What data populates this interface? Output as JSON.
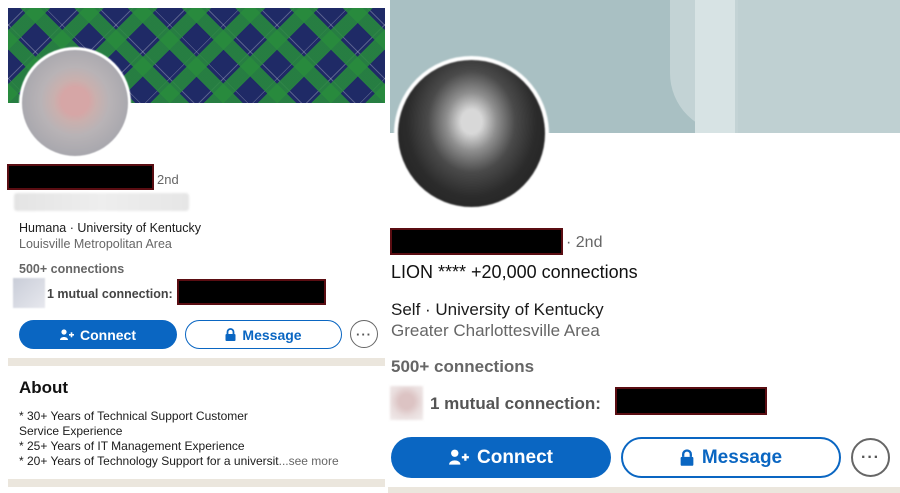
{
  "colors": {
    "accent": "#0a66c2",
    "muted_text": "#666666",
    "redaction": "#000000",
    "divider": "#ebe6dd"
  },
  "left_profile": {
    "degree": "2nd",
    "workplace": "Humana · University of Kentucky",
    "location": "Louisville Metropolitan Area",
    "connections": "500+ connections",
    "mutual_connection": "1 mutual connection:",
    "connect_label": "Connect",
    "connect_icon": "add-person-icon",
    "message_label": "Message",
    "message_icon": "lock-icon",
    "more_label": "···",
    "about": {
      "title": "About",
      "lines": [
        "* 30+ Years of Technical Support Customer",
        "Service Experience",
        "* 25+ Years of IT Management Experience",
        "* 20+ Years of Technology Support for a universit"
      ],
      "see_more": "...see more"
    }
  },
  "right_profile": {
    "degree": "· 2nd",
    "headline": "LION **** +20,000 connections",
    "workplace": "Self · University of Kentucky",
    "location": "Greater Charlottesville Area",
    "connections": "500+ connections",
    "mutual_connection": "1 mutual connection:",
    "connect_label": "Connect",
    "connect_icon": "add-person-icon",
    "message_label": "Message",
    "message_icon": "lock-icon",
    "more_label": "···"
  }
}
